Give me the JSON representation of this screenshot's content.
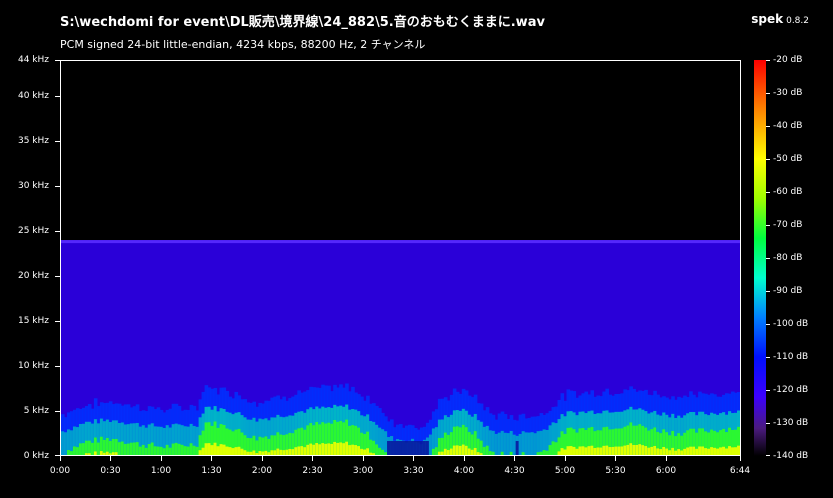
{
  "window": {
    "title": "S:\\wechdomi for event\\DL販売\\境界線\\24_882\\5.音のおもむくままに.wav",
    "subtitle": "PCM signed 24-bit little-endian, 4234 kbps, 88200 Hz, 2 チャンネル",
    "app_name": "spek",
    "app_version": "0.8.2"
  },
  "spectrogram": {
    "freq_axis": {
      "max_khz": 44,
      "ticks": [
        {
          "khz": 44,
          "label": "44 kHz"
        },
        {
          "khz": 40,
          "label": "40 kHz"
        },
        {
          "khz": 35,
          "label": "35 kHz"
        },
        {
          "khz": 30,
          "label": "30 kHz"
        },
        {
          "khz": 25,
          "label": "25 kHz"
        },
        {
          "khz": 20,
          "label": "20 kHz"
        },
        {
          "khz": 15,
          "label": "15 kHz"
        },
        {
          "khz": 10,
          "label": "10 kHz"
        },
        {
          "khz": 5,
          "label": "5 kHz"
        },
        {
          "khz": 0,
          "label": "0 kHz"
        }
      ]
    },
    "time_axis": {
      "max_seconds": 404,
      "ticks": [
        {
          "t": 0,
          "label": "0:00"
        },
        {
          "t": 30,
          "label": "0:30"
        },
        {
          "t": 60,
          "label": "1:00"
        },
        {
          "t": 90,
          "label": "1:30"
        },
        {
          "t": 120,
          "label": "2:00"
        },
        {
          "t": 150,
          "label": "2:30"
        },
        {
          "t": 180,
          "label": "3:00"
        },
        {
          "t": 210,
          "label": "3:30"
        },
        {
          "t": 240,
          "label": "4:00"
        },
        {
          "t": 270,
          "label": "4:30"
        },
        {
          "t": 300,
          "label": "5:00"
        },
        {
          "t": 330,
          "label": "5:30"
        },
        {
          "t": 360,
          "label": "6:00"
        },
        {
          "t": 404,
          "label": "6:44"
        }
      ]
    },
    "cutoff_khz": 24,
    "loud_profile": [
      [
        0,
        0.35
      ],
      [
        15,
        0.55
      ],
      [
        30,
        0.6
      ],
      [
        45,
        0.5
      ],
      [
        60,
        0.45
      ],
      [
        80,
        0.5
      ],
      [
        85,
        0.9
      ],
      [
        100,
        0.8
      ],
      [
        115,
        0.6
      ],
      [
        130,
        0.7
      ],
      [
        150,
        0.85
      ],
      [
        170,
        0.9
      ],
      [
        185,
        0.6
      ],
      [
        195,
        0.2
      ],
      [
        205,
        0.15
      ],
      [
        215,
        0.1
      ],
      [
        225,
        0.6
      ],
      [
        235,
        0.85
      ],
      [
        245,
        0.7
      ],
      [
        255,
        0.35
      ],
      [
        270,
        0.3
      ],
      [
        285,
        0.35
      ],
      [
        300,
        0.75
      ],
      [
        320,
        0.8
      ],
      [
        340,
        0.85
      ],
      [
        355,
        0.75
      ],
      [
        365,
        0.7
      ],
      [
        385,
        0.75
      ],
      [
        404,
        0.8
      ]
    ]
  },
  "colorbar": {
    "ticks": [
      "-20 dB",
      "-30 dB",
      "-40 dB",
      "-50 dB",
      "-60 dB",
      "-70 dB",
      "-80 dB",
      "-90 dB",
      "-100 dB",
      "-110 dB",
      "-120 dB",
      "-130 dB",
      "-140 dB"
    ]
  }
}
